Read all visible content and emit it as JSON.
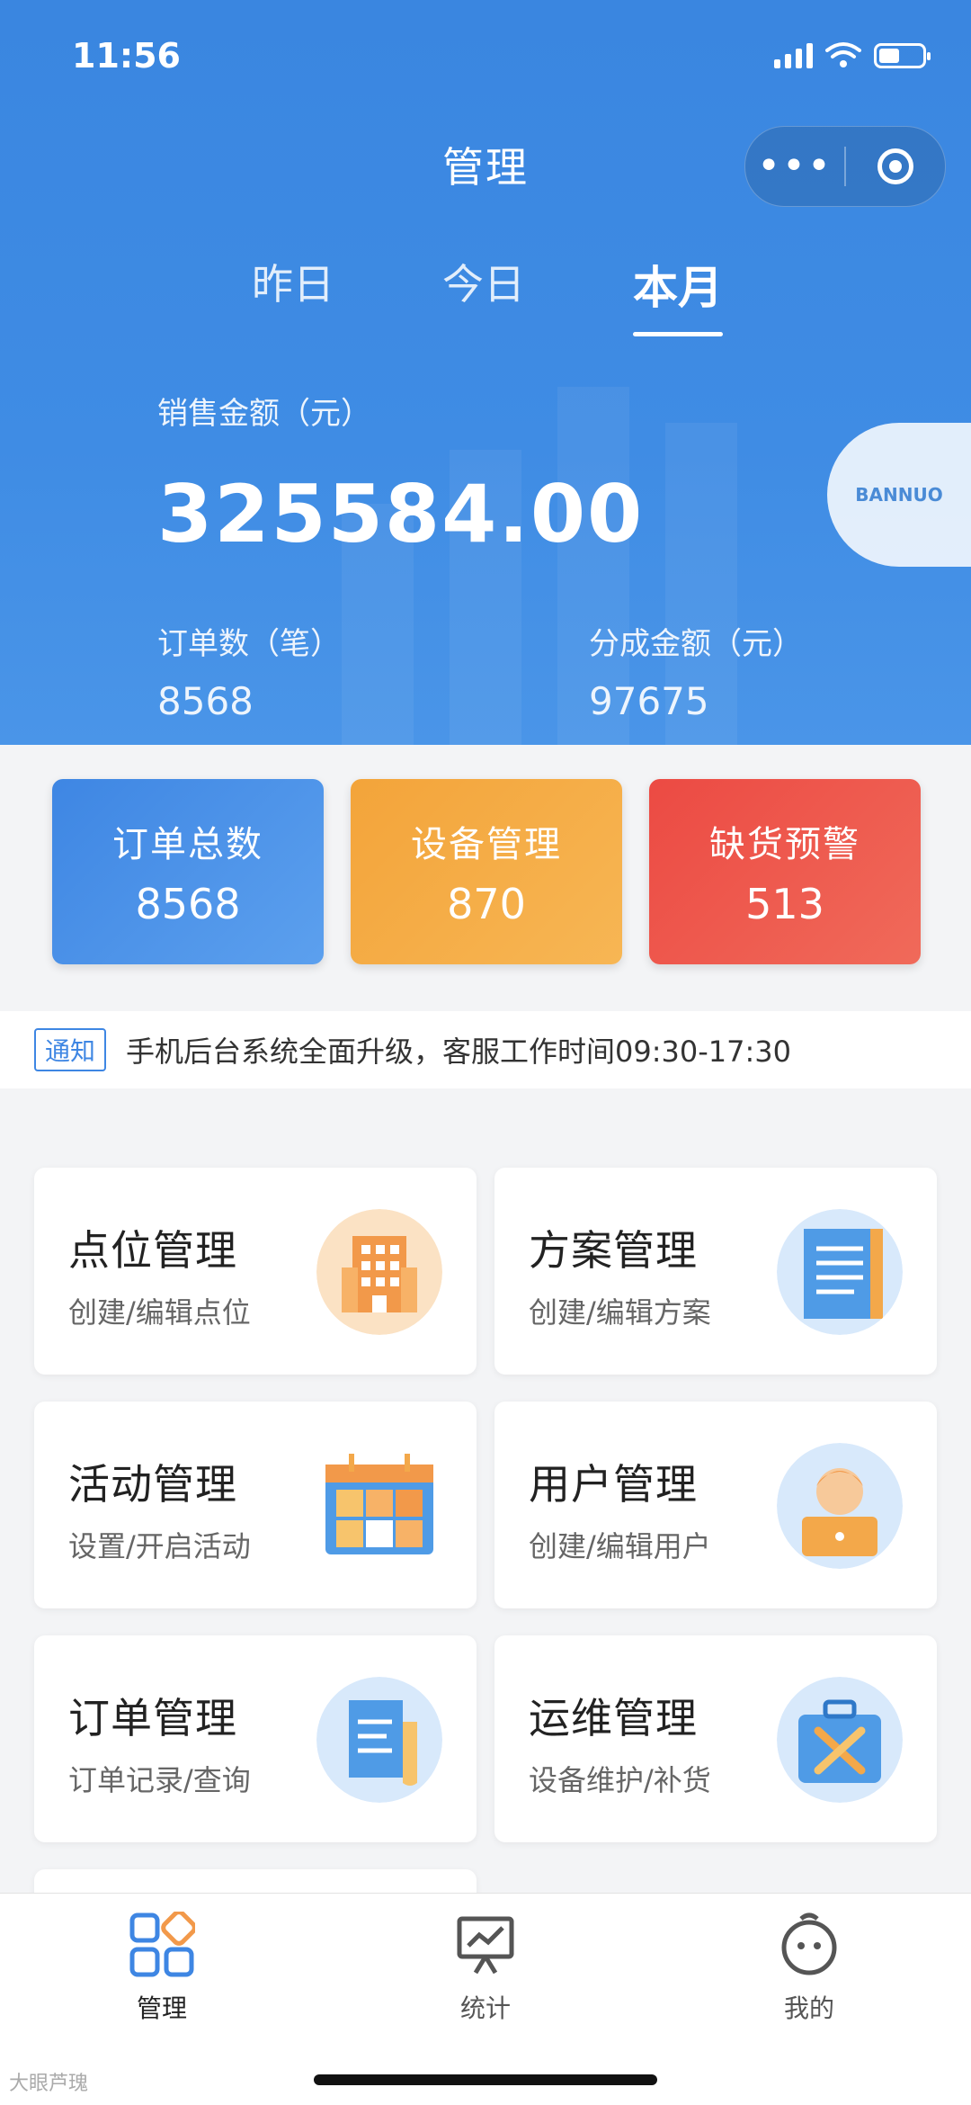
{
  "status": {
    "time": "11:56"
  },
  "header": {
    "title": "管理",
    "more": "•••"
  },
  "tabs": [
    {
      "label": "昨日"
    },
    {
      "label": "今日"
    },
    {
      "label": "本月"
    }
  ],
  "sales": {
    "label": "销售金额（元）",
    "amount": "325584.00",
    "orders_label": "订单数（笔）",
    "orders_value": "8568",
    "share_label": "分成金额（元）",
    "share_value": "97675"
  },
  "logo": {
    "text": "BANNUO"
  },
  "cards": [
    {
      "title": "订单总数",
      "value": "8568",
      "color": "#4a90e6"
    },
    {
      "title": "设备管理",
      "value": "870",
      "color": "#f4a93f"
    },
    {
      "title": "缺货预警",
      "value": "513",
      "color": "#ee5048"
    }
  ],
  "notice": {
    "tag": "通知",
    "text": "手机后台系统全面升级，客服工作时间09:30-17:30"
  },
  "menu": [
    {
      "title": "点位管理",
      "subtitle": "创建/编辑点位",
      "icon": "building-icon"
    },
    {
      "title": "方案管理",
      "subtitle": "创建/编辑方案",
      "icon": "document-icon"
    },
    {
      "title": "活动管理",
      "subtitle": "设置/开启活动",
      "icon": "calendar-icon"
    },
    {
      "title": "用户管理",
      "subtitle": "创建/编辑用户",
      "icon": "user-icon"
    },
    {
      "title": "订单管理",
      "subtitle": "订单记录/查询",
      "icon": "order-icon"
    },
    {
      "title": "运维管理",
      "subtitle": "设备维护/补货",
      "icon": "toolbox-icon"
    }
  ],
  "tabbar": [
    {
      "label": "管理",
      "icon": "grid-icon"
    },
    {
      "label": "统计",
      "icon": "chart-board-icon"
    },
    {
      "label": "我的",
      "icon": "profile-face-icon"
    }
  ],
  "watermark": "大眼芦瑰"
}
